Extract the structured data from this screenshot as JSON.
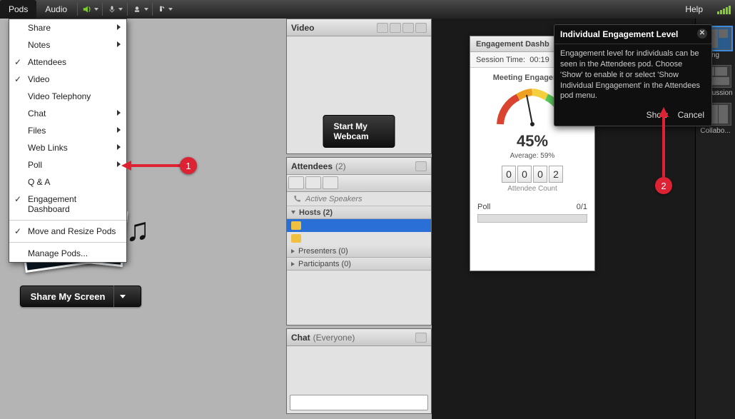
{
  "menubar": {
    "items": [
      "Pods",
      "Audio"
    ],
    "help": "Help"
  },
  "dropdown": {
    "share": "Share",
    "notes": "Notes",
    "attendees": "Attendees",
    "video": "Video",
    "telephony": "Video Telephony",
    "chat": "Chat",
    "files": "Files",
    "weblinks": "Web Links",
    "poll": "Poll",
    "qa": "Q & A",
    "engagement": "Engagement Dashboard",
    "moveresize": "Move and Resize Pods",
    "manage": "Manage Pods..."
  },
  "sharepod": {
    "button": "Share My Screen"
  },
  "videopod": {
    "title": "Video",
    "button": "Start My Webcam"
  },
  "attpod": {
    "title": "Attendees",
    "count": "(2)",
    "activespeakers": "Active Speakers",
    "hosts": "Hosts (2)",
    "presenters": "Presenters (0)",
    "participants": "Participants (0)"
  },
  "chatpod": {
    "title": "Chat",
    "scope": "(Everyone)"
  },
  "dashpod": {
    "title": "Engagement Dashb",
    "session_label": "Session Time:",
    "session_time": "00:19",
    "gaugetitle": "Meeting Engagement",
    "percent": "45%",
    "avg": "Average: 59%",
    "digits": [
      "0",
      "0",
      "0",
      "2"
    ],
    "counterlabel": "Attendee Count",
    "poll_label": "Poll",
    "poll_value": "0/1"
  },
  "tooltip": {
    "title": "Individual Engagement Level",
    "body": "Engagement level for individuals can be seen in the Attendees pod. Choose 'Show' to enable it or select 'Show Individual Engagement' in the Attendees pod menu.",
    "show": "Show",
    "cancel": "Cancel"
  },
  "layouts": {
    "l1": "ng",
    "l2": "Discussion",
    "l3": "Collabo..."
  },
  "callouts": {
    "one": "1",
    "two": "2"
  },
  "chart_data": {
    "type": "table",
    "title": "Engagement Dashboard",
    "metrics": {
      "session_time": "00:19",
      "meeting_engagement_percent": 45,
      "average_percent": 59,
      "attendee_count": 2,
      "poll_responses": 0,
      "poll_total": 1
    }
  }
}
